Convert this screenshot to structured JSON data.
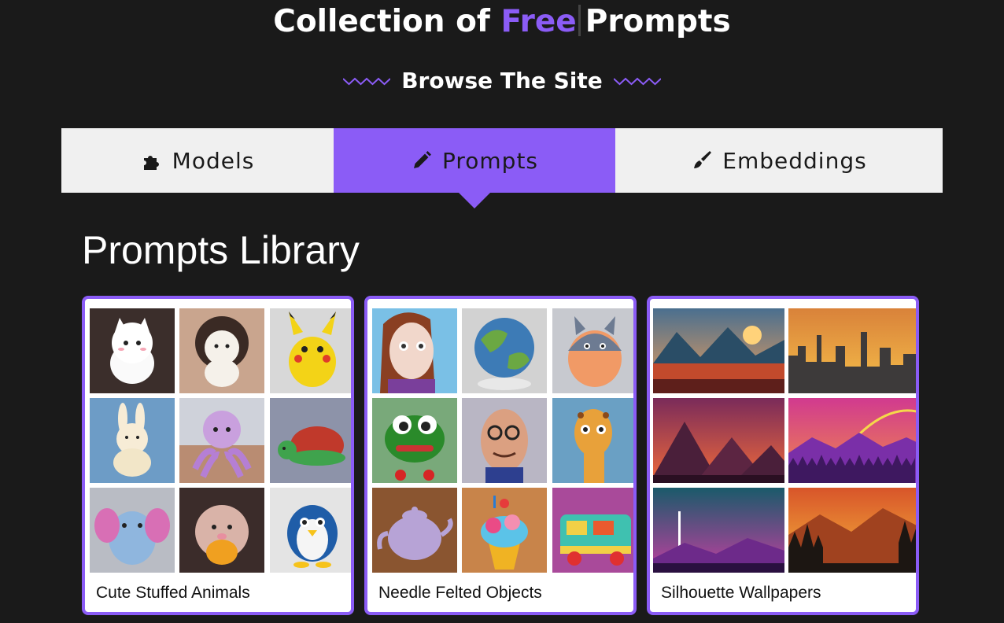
{
  "header": {
    "title_pre": "Collection of ",
    "title_accent": "Free",
    "title_post": "Prompts",
    "browse_label": "Browse The Site"
  },
  "tabs": [
    {
      "label": "Models",
      "icon": "puzzle-icon",
      "active": false
    },
    {
      "label": "Prompts",
      "icon": "pencil-icon",
      "active": true
    },
    {
      "label": "Embeddings",
      "icon": "brush-icon",
      "active": false
    }
  ],
  "library": {
    "title": "Prompts Library",
    "cards": [
      {
        "label": "Cute Stuffed Animals"
      },
      {
        "label": "Needle Felted Objects"
      },
      {
        "label": "Silhouette Wallpapers"
      }
    ]
  },
  "colors": {
    "accent": "#8b5cf6",
    "background": "#1a1a1a",
    "tab_bg": "#f0f0f0"
  }
}
